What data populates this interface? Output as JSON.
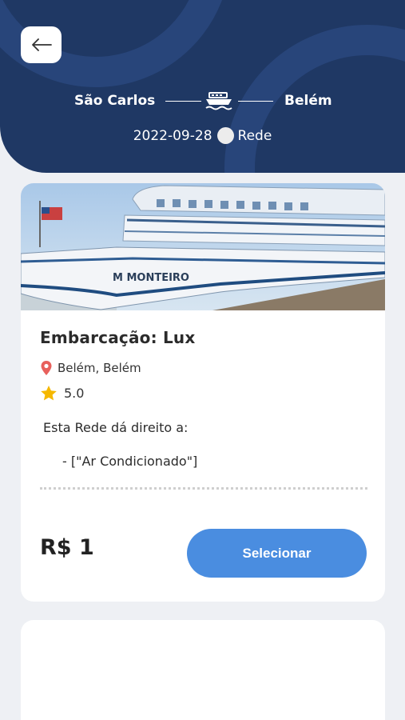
{
  "header": {
    "origin": "São Carlos",
    "destination": "Belém",
    "date": "2022-09-28",
    "accommodation": "Rede",
    "colors": {
      "background": "#1f3864",
      "text": "#ffffff"
    },
    "icons": {
      "back": "arrow-left-icon",
      "transport": "boat-icon"
    }
  },
  "card": {
    "title": "Embarcação: Lux",
    "location": "Belém, Belém",
    "location_icon": "map-pin-icon",
    "rating": "5.0",
    "rating_icon": "star-icon",
    "perks_title": "Esta Rede dá direito a:",
    "perks": [
      "- [\"Ar Condicionado\"]"
    ],
    "price": "R$ 1",
    "select_label": "Selecionar",
    "accent_color": "#4a8de0"
  }
}
